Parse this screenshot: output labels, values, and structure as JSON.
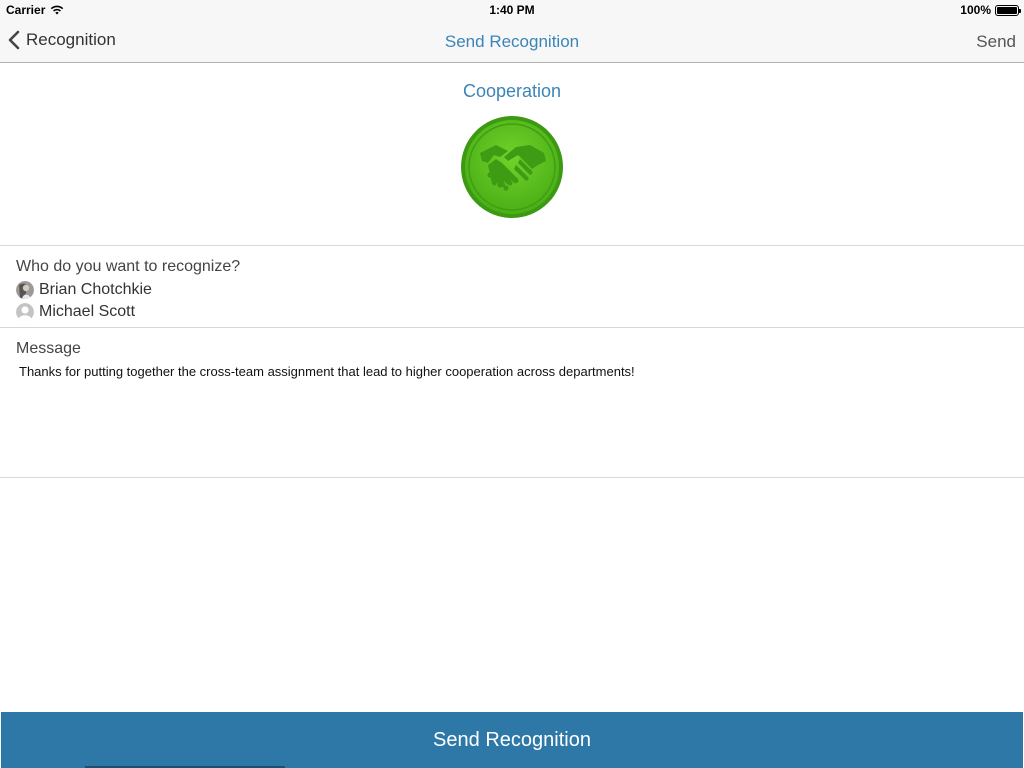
{
  "status_bar": {
    "carrier": "Carrier",
    "time": "1:40 PM",
    "battery": "100%",
    "battery_level": 1.0
  },
  "nav": {
    "back_label": "Recognition",
    "title": "Send Recognition",
    "send_label": "Send"
  },
  "badge": {
    "name": "Cooperation",
    "icon": "handshake-icon",
    "color": "#4cb61a"
  },
  "recipients": {
    "label": "Who do you want to recognize?",
    "people": [
      {
        "name": "Brian Chotchkie",
        "avatar": "photo-avatar"
      },
      {
        "name": "Michael Scott",
        "avatar": "default-avatar"
      }
    ]
  },
  "message": {
    "label": "Message",
    "text": "Thanks for putting together the cross-team assignment that lead to higher cooperation across departments!"
  },
  "footer": {
    "send_button_label": "Send Recognition"
  },
  "colors": {
    "accent": "#3a85b8",
    "button": "#2e78a8"
  }
}
